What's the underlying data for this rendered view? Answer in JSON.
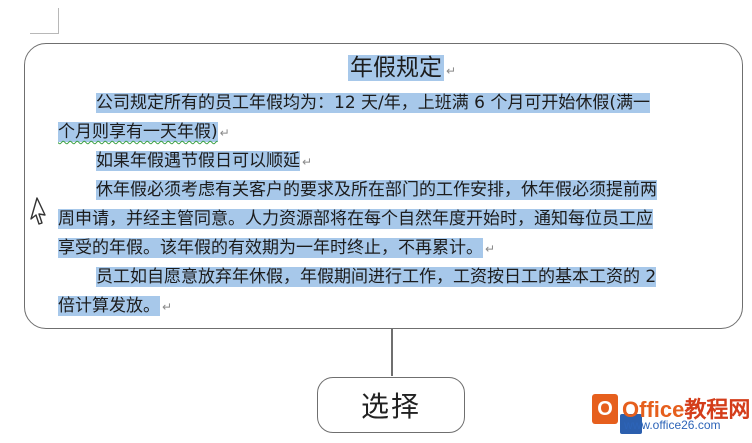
{
  "document": {
    "title": "年假规定",
    "paragraph_mark": "↵",
    "lines": [
      {
        "indent": true,
        "text": "公司规定所有的员工年假均为：12 天/年，上班满 6 个月可开始休假(满一"
      },
      {
        "indent": false,
        "text": "个月则享有一天年假)"
      },
      {
        "indent": true,
        "text": "如果年假遇节假日可以顺延"
      },
      {
        "indent": true,
        "text": "休年假必须考虑有关客户的要求及所在部门的工作安排，休年假必须提前两"
      },
      {
        "indent": false,
        "text": "周申请，并经主管同意。人力资源部将在每个自然年度开始时，通知每位员工应"
      },
      {
        "indent": false,
        "text": "享受的年假。该年假的有效期为一年时终止，不再累计。"
      },
      {
        "indent": true,
        "text": "员工如自愿意放弃年休假，年假期间进行工作，工资按日工的基本工资的 2"
      },
      {
        "indent": false,
        "text": "倍计算发放。"
      }
    ]
  },
  "action": {
    "label": "选择"
  },
  "watermark": {
    "logo_letter": "O",
    "brand_latin": "Office",
    "brand_cn": "教程网",
    "url": "www.office26.com"
  },
  "colors": {
    "selection": "#a7c8ea",
    "frame": "#6f6f6f",
    "brand_orange": "#e65f1d",
    "brand_blue": "#2d64b8"
  }
}
